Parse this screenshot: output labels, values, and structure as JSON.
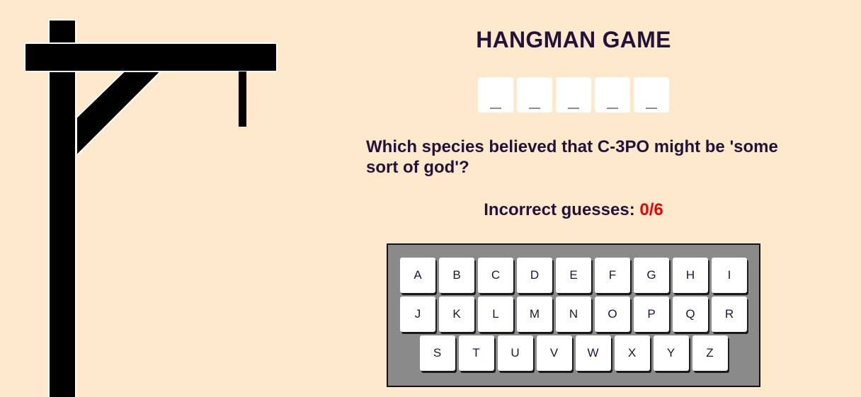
{
  "game": {
    "title": "HANGMAN GAME",
    "word_slots": [
      "_",
      "_",
      "_",
      "_",
      "_"
    ],
    "hint": "Which species believed that C-3PO might be 'some sort of god'?",
    "incorrect_label": "Incorrect guesses:",
    "incorrect_count": "0/6"
  },
  "keyboard": {
    "rows": [
      [
        "A",
        "B",
        "C",
        "D",
        "E",
        "F",
        "G",
        "H",
        "I"
      ],
      [
        "J",
        "K",
        "L",
        "M",
        "N",
        "O",
        "P",
        "Q",
        "R"
      ],
      [
        "S",
        "T",
        "U",
        "V",
        "W",
        "X",
        "Y",
        "Z"
      ]
    ]
  },
  "colors": {
    "background": "#ffe9cc",
    "text": "#221239",
    "incorrect_count": "#ee0000",
    "keyboard_bg": "#8a8a8a",
    "gallows": "#000000"
  }
}
